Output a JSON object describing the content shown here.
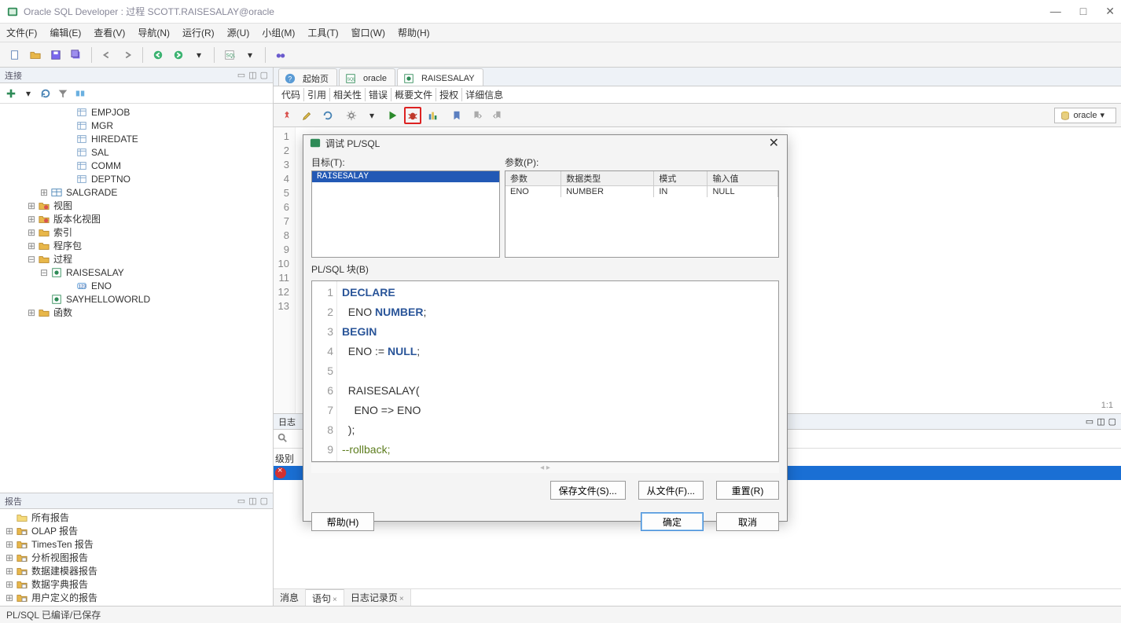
{
  "window": {
    "title": "Oracle SQL Developer : 过程 SCOTT.RAISESALAY@oracle"
  },
  "menubar": [
    "文件(F)",
    "编辑(E)",
    "查看(V)",
    "导航(N)",
    "运行(R)",
    "源(U)",
    "小组(M)",
    "工具(T)",
    "窗口(W)",
    "帮助(H)"
  ],
  "connection_panel": {
    "title": "连接",
    "tree": [
      {
        "indent": 5,
        "icon": "column",
        "label": "EMPJOB"
      },
      {
        "indent": 5,
        "icon": "column",
        "label": "MGR"
      },
      {
        "indent": 5,
        "icon": "column",
        "label": "HIREDATE"
      },
      {
        "indent": 5,
        "icon": "column",
        "label": "SAL"
      },
      {
        "indent": 5,
        "icon": "column",
        "label": "COMM"
      },
      {
        "indent": 5,
        "icon": "column",
        "label": "DEPTNO"
      },
      {
        "indent": 3,
        "exp": "+",
        "icon": "table",
        "label": "SALGRADE"
      },
      {
        "indent": 2,
        "exp": "+",
        "icon": "folder-v",
        "label": "视图"
      },
      {
        "indent": 2,
        "exp": "+",
        "icon": "folder-v",
        "label": "版本化视图"
      },
      {
        "indent": 2,
        "exp": "+",
        "icon": "folder",
        "label": "索引"
      },
      {
        "indent": 2,
        "exp": "+",
        "icon": "folder",
        "label": "程序包"
      },
      {
        "indent": 2,
        "exp": "-",
        "icon": "folder",
        "label": "过程"
      },
      {
        "indent": 3,
        "exp": "-",
        "icon": "proc",
        "label": "RAISESALAY",
        "selected": false
      },
      {
        "indent": 5,
        "icon": "param",
        "label": "ENO"
      },
      {
        "indent": 3,
        "icon": "proc",
        "label": "SAYHELLOWORLD"
      },
      {
        "indent": 2,
        "exp": "+",
        "icon": "folder",
        "label": "函数"
      }
    ]
  },
  "reports_panel": {
    "title": "报告",
    "items": [
      {
        "indent": 0,
        "icon": "folder-o",
        "label": "所有报告"
      },
      {
        "indent": 0,
        "exp": "+",
        "icon": "folder-r",
        "label": "OLAP 报告"
      },
      {
        "indent": 0,
        "exp": "+",
        "icon": "folder-r",
        "label": "TimesTen 报告"
      },
      {
        "indent": 0,
        "exp": "+",
        "icon": "folder-r",
        "label": "分析视图报告"
      },
      {
        "indent": 0,
        "exp": "+",
        "icon": "folder-r",
        "label": "数据建模器报告"
      },
      {
        "indent": 0,
        "exp": "+",
        "icon": "folder-r",
        "label": "数据字典报告"
      },
      {
        "indent": 0,
        "exp": "+",
        "icon": "folder-r",
        "label": "用户定义的报告"
      }
    ]
  },
  "editor": {
    "tabs": [
      {
        "label": "起始页",
        "icon": "help"
      },
      {
        "label": "oracle",
        "icon": "sql"
      },
      {
        "label": "RAISESALAY",
        "icon": "proc",
        "active": true
      }
    ],
    "subtabs": [
      "代码",
      "引用",
      "相关性",
      "错误",
      "概要文件",
      "授权",
      "详细信息"
    ],
    "db_selector": "oracle",
    "cursor_info": "1:1",
    "gutter_lines": 13
  },
  "logs": {
    "header": "日志",
    "level_label": "级别",
    "tabs": [
      "消息",
      "语句",
      "日志记录页"
    ]
  },
  "status_bar": "PL/SQL 已编译/已保存",
  "dialog": {
    "title": "调试 PL/SQL",
    "target_label": "目标(T):",
    "target_list": [
      "RAISESALAY"
    ],
    "param_label": "参数(P):",
    "param_headers": [
      "参数",
      "数据类型",
      "模式",
      "输入值"
    ],
    "param_rows": [
      [
        "ENO",
        "NUMBER",
        "IN",
        "NULL"
      ]
    ],
    "block_label": "PL/SQL 块(B)",
    "code_lines": [
      {
        "n": 1,
        "html": "<span class='kw'>DECLARE</span>"
      },
      {
        "n": 2,
        "html": "  ENO <span class='kw'>NUMBER</span>;"
      },
      {
        "n": 3,
        "html": "<span class='kw'>BEGIN</span>"
      },
      {
        "n": 4,
        "html": "  ENO := <span class='kw'>NULL</span>;"
      },
      {
        "n": 5,
        "html": ""
      },
      {
        "n": 6,
        "html": "  RAISESALAY("
      },
      {
        "n": 7,
        "html": "    ENO =&gt; ENO"
      },
      {
        "n": 8,
        "html": "  );"
      },
      {
        "n": 9,
        "html": "<span class='comment'>--rollback;</span>"
      }
    ],
    "buttons": {
      "save_file": "保存文件(S)...",
      "from_file": "从文件(F)...",
      "reset": "重置(R)",
      "help": "帮助(H)",
      "ok": "确定",
      "cancel": "取消"
    }
  }
}
